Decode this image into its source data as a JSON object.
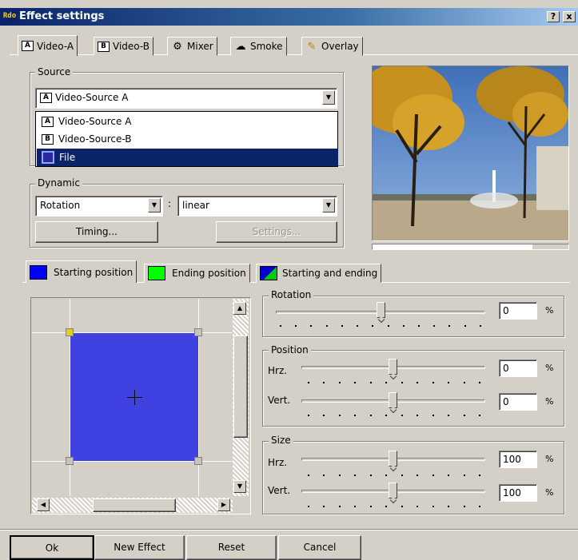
{
  "window": {
    "title": "Effect settings",
    "app_icon_text": "Rdo",
    "help_button": "?",
    "close_button": "x"
  },
  "main_tabs": [
    {
      "label": "Video-A",
      "icon": "A",
      "active": true
    },
    {
      "label": "Video-B",
      "icon": "B",
      "active": false
    },
    {
      "label": "Mixer",
      "icon": "mixer-icon",
      "active": false
    },
    {
      "label": "Smoke",
      "icon": "smoke-icon",
      "active": false
    },
    {
      "label": "Overlay",
      "icon": "overlay-icon",
      "active": false
    }
  ],
  "source": {
    "group_label": "Source",
    "selected": "Video-Source A",
    "selected_icon": "A",
    "dropdown_open": true,
    "options": [
      {
        "label": "Video-Source A",
        "icon": "A",
        "highlighted": false
      },
      {
        "label": "Video-Source-B",
        "icon": "B",
        "highlighted": false
      },
      {
        "label": "File",
        "icon": "film-icon",
        "highlighted": true
      }
    ]
  },
  "dynamic": {
    "group_label": "Dynamic",
    "mode": "Rotation",
    "separator": ":",
    "interpolation": "linear",
    "timing_button": "Timing...",
    "settings_button": "Settings...",
    "settings_enabled": false
  },
  "preview": {
    "description_icon": "preview-image-icon"
  },
  "position_tabs": [
    {
      "label": "Starting position",
      "color": "#0000ff",
      "active": true
    },
    {
      "label": "Ending position",
      "color": "#00ff00",
      "active": false
    },
    {
      "label": "Starting and ending",
      "color": "#0000cc",
      "active": false
    }
  ],
  "canvas": {
    "rect_color": "#3f42e0"
  },
  "rotation": {
    "group_label": "Rotation",
    "value": "0",
    "unit": "%",
    "slider_fraction": 0.5
  },
  "position": {
    "group_label": "Position",
    "hrz_label": "Hrz.",
    "hrz_value": "0",
    "vert_label": "Vert.",
    "vert_value": "0",
    "unit": "%",
    "hrz_fraction": 0.5,
    "vert_fraction": 0.5
  },
  "size": {
    "group_label": "Size",
    "hrz_label": "Hrz.",
    "hrz_value": "100",
    "vert_label": "Vert.",
    "vert_value": "100",
    "unit": "%",
    "hrz_fraction": 0.5,
    "vert_fraction": 0.5
  },
  "footer": {
    "ok": "Ok",
    "new_effect": "New Effect",
    "reset": "Reset",
    "cancel": "Cancel"
  }
}
